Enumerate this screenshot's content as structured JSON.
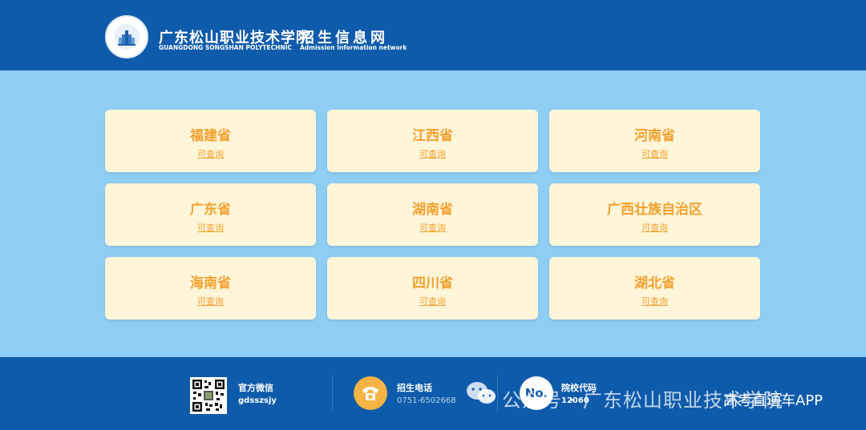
{
  "header": {
    "school_name_cn": "广东松山职业技术学院",
    "school_name_en": "GUANGDONG SONGSHAN POLYTECHNIC",
    "site_name_cn": "招生信息网",
    "site_name_en": "Admission Information network"
  },
  "provinces": [
    {
      "name": "福建省",
      "status": "可查询"
    },
    {
      "name": "江西省",
      "status": "可查询"
    },
    {
      "name": "河南省",
      "status": "可查询"
    },
    {
      "name": "广东省",
      "status": "可查询"
    },
    {
      "name": "湖南省",
      "status": "可查询"
    },
    {
      "name": "广西壮族自治区",
      "status": "可查询"
    },
    {
      "name": "海南省",
      "status": "可查询"
    },
    {
      "name": "四川省",
      "status": "可查询"
    },
    {
      "name": "湖北省",
      "status": "可查询"
    }
  ],
  "footer": {
    "wechat_label": "官方微信",
    "wechat_value": "gdsszsjy",
    "phone_label": "招生电话",
    "phone_value": "0751-6502668",
    "code_label": "院校代码",
    "code_value": "12060",
    "code_badge": "No."
  },
  "watermark": {
    "account_text": "公众号 · 广东松山职业技术学院",
    "app_text": "高考直通车APP"
  },
  "colors": {
    "header_bg": "#0f5bab",
    "page_bg": "#8ecdf4",
    "card_bg": "#fff5d9",
    "accent_orange": "#f2a12e",
    "phone_icon_bg": "#f5b443"
  },
  "icons": {
    "logo": "school-logo-icon",
    "qr": "qr-code-icon",
    "phone": "phone-icon",
    "number": "number-badge-icon",
    "wechat": "wechat-icon"
  }
}
